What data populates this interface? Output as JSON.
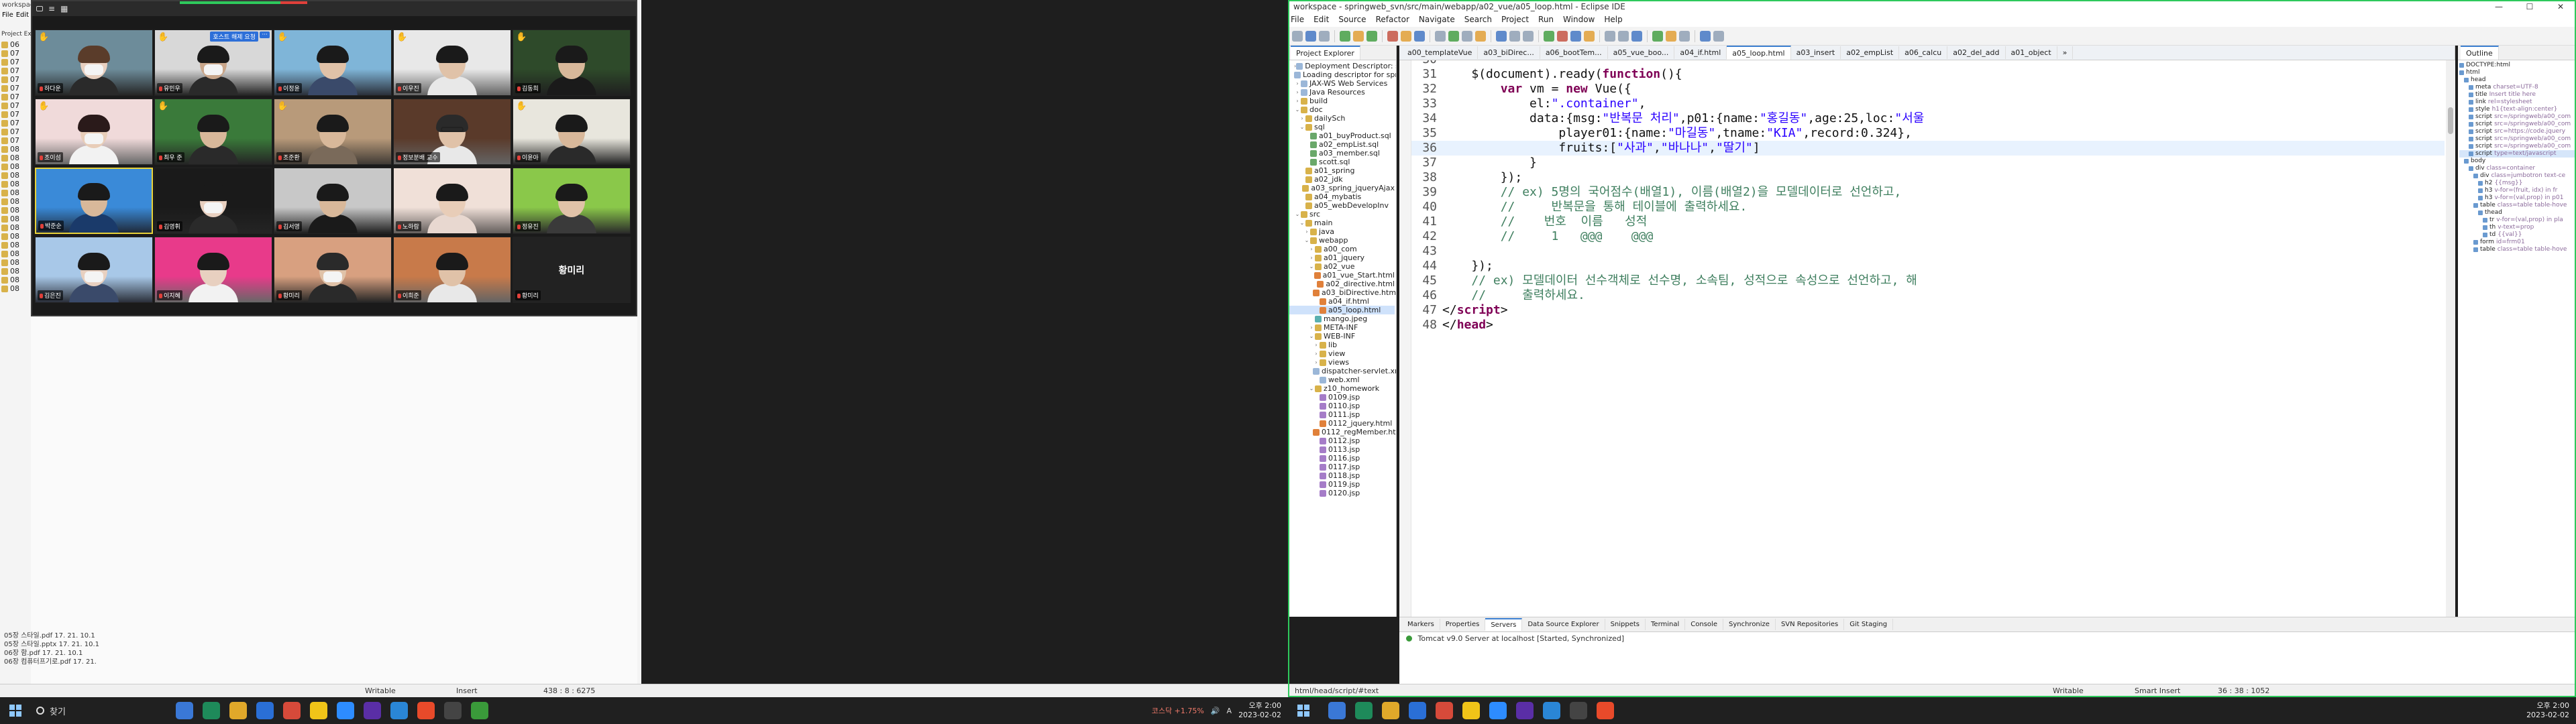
{
  "left_screen": {
    "eclipse_fragment": {
      "title": "workspace",
      "menu": [
        "File",
        "Edit"
      ],
      "view_label": "Project Explorer",
      "tree_rows": [
        "06",
        "07",
        "07",
        "07",
        "07",
        "07",
        "07",
        "07",
        "07",
        "07",
        "07",
        "07",
        "08",
        "08",
        "08",
        "08",
        "08",
        "08",
        "08",
        "08",
        "08",
        "08",
        "08",
        "08",
        "08",
        "08",
        "08",
        "08",
        "08"
      ],
      "files_bottom": [
        "05장 스타일.pdf 17. 21. 10.1",
        "05장 스타일.pptx 17. 21. 10.1",
        "06장 함.pdf 17. 21. 10.1",
        "06장 컴퓨터프기로.pdf 17. 21."
      ],
      "status": {
        "writable": "Writable",
        "insert": "Insert",
        "position": "438 : 8 : 6275"
      }
    },
    "zoom": {
      "participants": [
        {
          "name": "하다운",
          "hand": true,
          "speaking": false
        },
        {
          "name": "유민우",
          "hand": true,
          "speaking": false,
          "badge": "호스트 해제 요청",
          "more": "···"
        },
        {
          "name": "이정윤",
          "hand": true,
          "speaking": false
        },
        {
          "name": "이우진",
          "hand": true,
          "speaking": false
        },
        {
          "name": "김동희",
          "hand": true,
          "speaking": false
        },
        {
          "name": "조이섬",
          "hand": true,
          "speaking": false
        },
        {
          "name": "최우 준",
          "hand": true,
          "speaking": false
        },
        {
          "name": "조준환",
          "hand": true,
          "speaking": false
        },
        {
          "name": "정보분배 교수",
          "hand": false,
          "speaking": false
        },
        {
          "name": "이윤아",
          "hand": true,
          "speaking": false
        },
        {
          "name": "박준순",
          "hand": false,
          "speaking": true
        },
        {
          "name": "김영휘",
          "hand": false,
          "speaking": false
        },
        {
          "name": "김서영",
          "hand": false,
          "speaking": false
        },
        {
          "name": "노하람",
          "hand": false,
          "speaking": false
        },
        {
          "name": "정유진",
          "hand": false,
          "speaking": false
        },
        {
          "name": "김은진",
          "hand": false,
          "speaking": false
        },
        {
          "name": "이지혜",
          "hand": false,
          "speaking": false
        },
        {
          "name": "황미리",
          "hand": false,
          "speaking": false
        },
        {
          "name": "이희준",
          "hand": false,
          "speaking": false
        },
        {
          "name": "황미리",
          "hand": false,
          "speaking": false,
          "name_only": true
        }
      ]
    },
    "taskbar": {
      "search_label": "찾기",
      "tray_text": "코스닥 +1.75%",
      "ime": "A",
      "time": "오후 2:00",
      "date": "2023-02-02"
    }
  },
  "right_screen": {
    "window_title": "workspace - springweb_svn/src/main/webapp/a02_vue/a05_loop.html - Eclipse IDE",
    "menu": [
      "File",
      "Edit",
      "Source",
      "Refactor",
      "Navigate",
      "Search",
      "Project",
      "Run",
      "Window",
      "Help"
    ],
    "package_explorer": {
      "title": "Project Explorer",
      "tree": [
        {
          "indent": 1,
          "label": "Deployment Descriptor: springweb",
          "type": "file",
          "tw": "›"
        },
        {
          "indent": 1,
          "label": "Loading descriptor for springweb",
          "type": "file",
          "tw": ""
        },
        {
          "indent": 1,
          "label": "JAX-WS Web Services",
          "type": "file",
          "tw": "›"
        },
        {
          "indent": 1,
          "label": "Java Resources",
          "type": "file",
          "tw": "›"
        },
        {
          "indent": 1,
          "label": "build",
          "type": "folder",
          "tw": "›"
        },
        {
          "indent": 1,
          "label": "doc",
          "type": "folder",
          "tw": "⌄"
        },
        {
          "indent": 2,
          "label": "dailySch",
          "type": "folder",
          "tw": "›"
        },
        {
          "indent": 2,
          "label": "sql",
          "type": "folder",
          "tw": "⌄"
        },
        {
          "indent": 3,
          "label": "a01_buyProduct.sql",
          "type": "sql",
          "tw": ""
        },
        {
          "indent": 3,
          "label": "a02_empList.sql",
          "type": "sql",
          "tw": ""
        },
        {
          "indent": 3,
          "label": "a03_member.sql",
          "type": "sql",
          "tw": ""
        },
        {
          "indent": 3,
          "label": "scott.sql",
          "type": "sql",
          "tw": ""
        },
        {
          "indent": 2,
          "label": "a01_spring",
          "type": "folder",
          "tw": ""
        },
        {
          "indent": 2,
          "label": "a02_jdk",
          "type": "folder",
          "tw": ""
        },
        {
          "indent": 2,
          "label": "a03_spring_jqueryAjax",
          "type": "folder",
          "tw": ""
        },
        {
          "indent": 2,
          "label": "a04_mybatis",
          "type": "folder",
          "tw": ""
        },
        {
          "indent": 2,
          "label": "a05_webDevelopInv",
          "type": "folder",
          "tw": ""
        },
        {
          "indent": 1,
          "label": "src",
          "type": "folder",
          "tw": "⌄"
        },
        {
          "indent": 2,
          "label": "main",
          "type": "folder",
          "tw": "⌄"
        },
        {
          "indent": 3,
          "label": "java",
          "type": "folder",
          "tw": "›"
        },
        {
          "indent": 3,
          "label": "webapp",
          "type": "folder",
          "tw": "⌄"
        },
        {
          "indent": 4,
          "label": "a00_com",
          "type": "folder",
          "tw": "›"
        },
        {
          "indent": 4,
          "label": "a01_jquery",
          "type": "folder",
          "tw": "›"
        },
        {
          "indent": 4,
          "label": "a02_vue",
          "type": "folder",
          "tw": "⌄"
        },
        {
          "indent": 5,
          "label": "a01_vue_Start.html",
          "type": "html",
          "tw": ""
        },
        {
          "indent": 5,
          "label": "a02_directive.html",
          "type": "html",
          "tw": ""
        },
        {
          "indent": 5,
          "label": "a03_biDirective.html",
          "type": "html",
          "tw": ""
        },
        {
          "indent": 5,
          "label": "a04_if.html",
          "type": "html",
          "tw": ""
        },
        {
          "indent": 5,
          "label": "a05_loop.html",
          "type": "html",
          "tw": "",
          "selected": true
        },
        {
          "indent": 4,
          "label": "mango.jpeg",
          "type": "img",
          "tw": ""
        },
        {
          "indent": 4,
          "label": "META-INF",
          "type": "folder",
          "tw": "›"
        },
        {
          "indent": 4,
          "label": "WEB-INF",
          "type": "folder",
          "tw": "⌄"
        },
        {
          "indent": 5,
          "label": "lib",
          "type": "folder",
          "tw": "›"
        },
        {
          "indent": 5,
          "label": "view",
          "type": "folder",
          "tw": "›"
        },
        {
          "indent": 5,
          "label": "views",
          "type": "folder",
          "tw": "›"
        },
        {
          "indent": 5,
          "label": "dispatcher-servlet.xml",
          "type": "file",
          "tw": ""
        },
        {
          "indent": 5,
          "label": "web.xml",
          "type": "file",
          "tw": ""
        },
        {
          "indent": 4,
          "label": "z10_homework",
          "type": "folder",
          "tw": "⌄"
        },
        {
          "indent": 5,
          "label": "0109.jsp",
          "type": "jsp",
          "tw": ""
        },
        {
          "indent": 5,
          "label": "0110.jsp",
          "type": "jsp",
          "tw": ""
        },
        {
          "indent": 5,
          "label": "0111.jsp",
          "type": "jsp",
          "tw": ""
        },
        {
          "indent": 5,
          "label": "0112_jquery.html",
          "type": "html",
          "tw": ""
        },
        {
          "indent": 5,
          "label": "0112_regMember.html",
          "type": "html",
          "tw": ""
        },
        {
          "indent": 5,
          "label": "0112.jsp",
          "type": "jsp",
          "tw": ""
        },
        {
          "indent": 5,
          "label": "0113.jsp",
          "type": "jsp",
          "tw": ""
        },
        {
          "indent": 5,
          "label": "0116.jsp",
          "type": "jsp",
          "tw": ""
        },
        {
          "indent": 5,
          "label": "0117.jsp",
          "type": "jsp",
          "tw": ""
        },
        {
          "indent": 5,
          "label": "0118.jsp",
          "type": "jsp",
          "tw": ""
        },
        {
          "indent": 5,
          "label": "0119.jsp",
          "type": "jsp",
          "tw": ""
        },
        {
          "indent": 5,
          "label": "0120.jsp",
          "type": "jsp",
          "tw": ""
        }
      ]
    },
    "editor_tabs": [
      "a00_templateVue",
      "a03_biDirec...",
      "a06_bootTem...",
      "a05_vue_boo...",
      "a04_if.html",
      "a05_loop.html",
      "a03_insert",
      "a02_empList",
      "a06_calcu",
      "a02_del_add",
      "a01_object",
      "»"
    ],
    "active_tab_index": 5,
    "code_lines": [
      {
        "n": "30",
        "segs": []
      },
      {
        "n": "31",
        "segs": [
          [
            "plain",
            "    $(document).ready("
          ],
          [
            "kw",
            "function"
          ],
          [
            "plain",
            "(){"
          ]
        ]
      },
      {
        "n": "32",
        "segs": [
          [
            "plain",
            "        "
          ],
          [
            "kw",
            "var"
          ],
          [
            "plain",
            " vm = "
          ],
          [
            "kw",
            "new"
          ],
          [
            "plain",
            " Vue({"
          ]
        ]
      },
      {
        "n": "33",
        "segs": [
          [
            "plain",
            "            el:"
          ],
          [
            "str",
            "\".container\""
          ],
          [
            "plain",
            ","
          ]
        ]
      },
      {
        "n": "34",
        "segs": [
          [
            "plain",
            "            data:{msg:"
          ],
          [
            "str",
            "\"반복문 처리\""
          ],
          [
            "plain",
            ",p01:{name:"
          ],
          [
            "str",
            "\"홍길동\""
          ],
          [
            "plain",
            ",age:25,loc:"
          ],
          [
            "str",
            "\"서울"
          ]
        ]
      },
      {
        "n": "35",
        "segs": [
          [
            "plain",
            "                player01:{name:"
          ],
          [
            "str",
            "\"마길동\""
          ],
          [
            "plain",
            ",tname:"
          ],
          [
            "str",
            "\"KIA\""
          ],
          [
            "plain",
            ",record:0.324},"
          ]
        ]
      },
      {
        "n": "36",
        "segs": [
          [
            "plain",
            "                fruits:["
          ],
          [
            "str",
            "\"사과\""
          ],
          [
            "plain",
            ","
          ],
          [
            "str",
            "\"바나나\""
          ],
          [
            "plain",
            ","
          ],
          [
            "str",
            "\"딸기\""
          ],
          [
            "plain",
            "]"
          ]
        ],
        "highlight": true
      },
      {
        "n": "37",
        "segs": [
          [
            "plain",
            "            }"
          ]
        ]
      },
      {
        "n": "38",
        "segs": [
          [
            "plain",
            "        });"
          ]
        ]
      },
      {
        "n": "39",
        "segs": [
          [
            "plain",
            "        "
          ],
          [
            "cm",
            "// ex) 5명의 국어점수(배열1), 이름(배열2)을 모델데이터로 선언하고,"
          ]
        ]
      },
      {
        "n": "40",
        "segs": [
          [
            "plain",
            "        "
          ],
          [
            "cm",
            "//     반복문을 통해 테이블에 출력하세요."
          ]
        ]
      },
      {
        "n": "41",
        "segs": [
          [
            "plain",
            "        "
          ],
          [
            "cm",
            "//    번호  이름   성적"
          ]
        ]
      },
      {
        "n": "42",
        "segs": [
          [
            "plain",
            "        "
          ],
          [
            "cm",
            "//     1   @@@    @@@"
          ]
        ]
      },
      {
        "n": "43",
        "segs": []
      },
      {
        "n": "44",
        "segs": [
          [
            "plain",
            "    });"
          ]
        ]
      },
      {
        "n": "45",
        "segs": [
          [
            "plain",
            "    "
          ],
          [
            "cm",
            "// ex) 모델데이터 선수객체로 선수명, 소속팀, 성적으로 속성으로 선언하고, 해"
          ]
        ]
      },
      {
        "n": "46",
        "segs": [
          [
            "plain",
            "    "
          ],
          [
            "cm",
            "//     출력하세요."
          ]
        ]
      },
      {
        "n": "47",
        "segs": [
          [
            "plain",
            "</"
          ],
          [
            "kw",
            "script"
          ],
          [
            "plain",
            ">"
          ]
        ]
      },
      {
        "n": "48",
        "segs": [
          [
            "plain",
            "</"
          ],
          [
            "kw",
            "head"
          ],
          [
            "plain",
            ">"
          ]
        ]
      }
    ],
    "outline": {
      "title": "Outline",
      "rows": [
        {
          "indent": 0,
          "tag": "DOCTYPE:html",
          "attr": ""
        },
        {
          "indent": 0,
          "tag": "html",
          "attr": ""
        },
        {
          "indent": 1,
          "tag": "head",
          "attr": ""
        },
        {
          "indent": 2,
          "tag": "meta",
          "attr": "charset=UTF-8"
        },
        {
          "indent": 2,
          "tag": "title",
          "attr": "Insert title here"
        },
        {
          "indent": 2,
          "tag": "link",
          "attr": "rel=stylesheet"
        },
        {
          "indent": 2,
          "tag": "style",
          "attr": "h1{text-align:center}"
        },
        {
          "indent": 2,
          "tag": "script",
          "attr": "src=/springweb/a00_com"
        },
        {
          "indent": 2,
          "tag": "script",
          "attr": "src=/springweb/a00_com"
        },
        {
          "indent": 2,
          "tag": "script",
          "attr": "src=https://code.jquery"
        },
        {
          "indent": 2,
          "tag": "script",
          "attr": "src=/springweb/a00_com"
        },
        {
          "indent": 2,
          "tag": "script",
          "attr": "src=/springweb/a00_com"
        },
        {
          "indent": 2,
          "tag": "script",
          "attr": "type=text/javascript",
          "sel": true
        },
        {
          "indent": 1,
          "tag": "body",
          "attr": ""
        },
        {
          "indent": 2,
          "tag": "div",
          "attr": "class=container"
        },
        {
          "indent": 3,
          "tag": "div",
          "attr": "class=jumbotron text-ce"
        },
        {
          "indent": 4,
          "tag": "h2",
          "attr": "{{msg}}"
        },
        {
          "indent": 4,
          "tag": "h3",
          "attr": "v-for=(fruit, idx) in fr"
        },
        {
          "indent": 4,
          "tag": "h3",
          "attr": "v-for=(val,prop) in p01"
        },
        {
          "indent": 3,
          "tag": "table",
          "attr": "class=table table-hove"
        },
        {
          "indent": 4,
          "tag": "thead",
          "attr": ""
        },
        {
          "indent": 5,
          "tag": "tr",
          "attr": "v-for=(val,prop) in pla"
        },
        {
          "indent": 5,
          "tag": "th",
          "attr": "v-text=prop"
        },
        {
          "indent": 5,
          "tag": "td",
          "attr": "{{val}}"
        },
        {
          "indent": 3,
          "tag": "form",
          "attr": "id=frm01"
        },
        {
          "indent": 3,
          "tag": "table",
          "attr": "class=table table-hove"
        }
      ]
    },
    "console": {
      "tabs": [
        "Markers",
        "Properties",
        "Servers",
        "Data Source Explorer",
        "Snippets",
        "Terminal",
        "Console",
        "Synchronize",
        "SVN Repositories",
        "Git Staging"
      ],
      "server_line": "Tomcat v9.0 Server at localhost  [Started, Synchronized]"
    },
    "status": {
      "path": "html/head/script/#text",
      "writable": "Writable",
      "insert": "Smart Insert",
      "position": "36 : 38 : 1052"
    },
    "taskbar": {
      "time": "오후 2:00",
      "date": "2023-02-02"
    }
  }
}
